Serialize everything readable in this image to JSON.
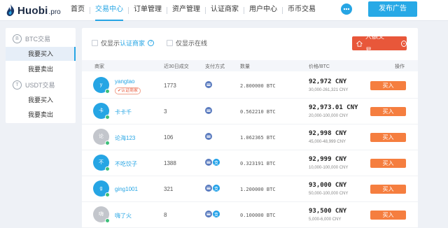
{
  "brand": {
    "name": "Huobi",
    "tld": ".pro"
  },
  "nav": [
    {
      "label": "首页"
    },
    {
      "label": "交易中心"
    },
    {
      "label": "订单管理"
    },
    {
      "label": "资产管理"
    },
    {
      "label": "认证商家"
    },
    {
      "label": "用户中心"
    },
    {
      "label": "币币交易"
    }
  ],
  "header": {
    "publish_label": "发布广告"
  },
  "sidebar": {
    "groups": [
      {
        "title": "BTC交易",
        "icon": "B",
        "items": [
          {
            "label": "我要买入"
          },
          {
            "label": "我要卖出"
          }
        ]
      },
      {
        "title": "USDT交易",
        "icon": "T",
        "items": [
          {
            "label": "我要买入"
          },
          {
            "label": "我要卖出"
          }
        ]
      }
    ]
  },
  "filters": {
    "only_certified_prefix": "仅显示",
    "only_certified_link": "认证商家",
    "only_online": "仅显示在线"
  },
  "bulk_trade_label": "大额交易",
  "table": {
    "headers": {
      "merchant": "商家",
      "trades_30d": "近30日成交",
      "payment": "支付方式",
      "quantity": "数量",
      "price": "价格/BTC",
      "action": "操作"
    },
    "rows": [
      {
        "avatar": "y",
        "avatar_color": "#26a5e4",
        "merchant": "yangtao",
        "badge": "认证商家",
        "trades": "1773",
        "payments": [
          "bank"
        ],
        "quantity": "2.800000 BTC",
        "price": "92,972  CNY",
        "limit": "30,000-261,321 CNY",
        "buy": "买入"
      },
      {
        "avatar": "卡",
        "avatar_color": "#26a5e4",
        "merchant": "卡卡千",
        "badge": "",
        "trades": "3",
        "payments": [
          "bank"
        ],
        "quantity": "0.562210 BTC",
        "price": "92,973.01  CNY",
        "limit": "20,000-100,000 CNY",
        "buy": "买入"
      },
      {
        "avatar": "论",
        "avatar_color": "#c3c6cc",
        "merchant": "论海123",
        "badge": "",
        "trades": "106",
        "payments": [
          "bank"
        ],
        "quantity": "1.062365 BTC",
        "price": "92,998  CNY",
        "limit": "45,000-48,999 CNY",
        "buy": "买入"
      },
      {
        "avatar": "不",
        "avatar_color": "#26a5e4",
        "merchant": "不吃饺子",
        "badge": "",
        "trades": "1388",
        "payments": [
          "bank",
          "alipay"
        ],
        "quantity": "0.323191 BTC",
        "price": "92,999  CNY",
        "limit": "10,000-100,000 CNY",
        "buy": "买入"
      },
      {
        "avatar": "g",
        "avatar_color": "#26a5e4",
        "merchant": "ging1001",
        "badge": "",
        "trades": "321",
        "payments": [
          "bank",
          "alipay"
        ],
        "quantity": "1.200000 BTC",
        "price": "93,000  CNY",
        "limit": "50,000-100,000 CNY",
        "buy": "买入"
      },
      {
        "avatar": "嗨",
        "avatar_color": "#c3c6cc",
        "merchant": "嗨了火",
        "badge": "",
        "trades": "8",
        "payments": [
          "bank",
          "alipay"
        ],
        "quantity": "0.100000 BTC",
        "price": "93,500  CNY",
        "limit": "5,000-6,000 CNY",
        "buy": "买入"
      }
    ]
  },
  "colors": {
    "accent": "#26a5e4",
    "buy": "#f57e3f",
    "bulk": "#e8573a"
  }
}
